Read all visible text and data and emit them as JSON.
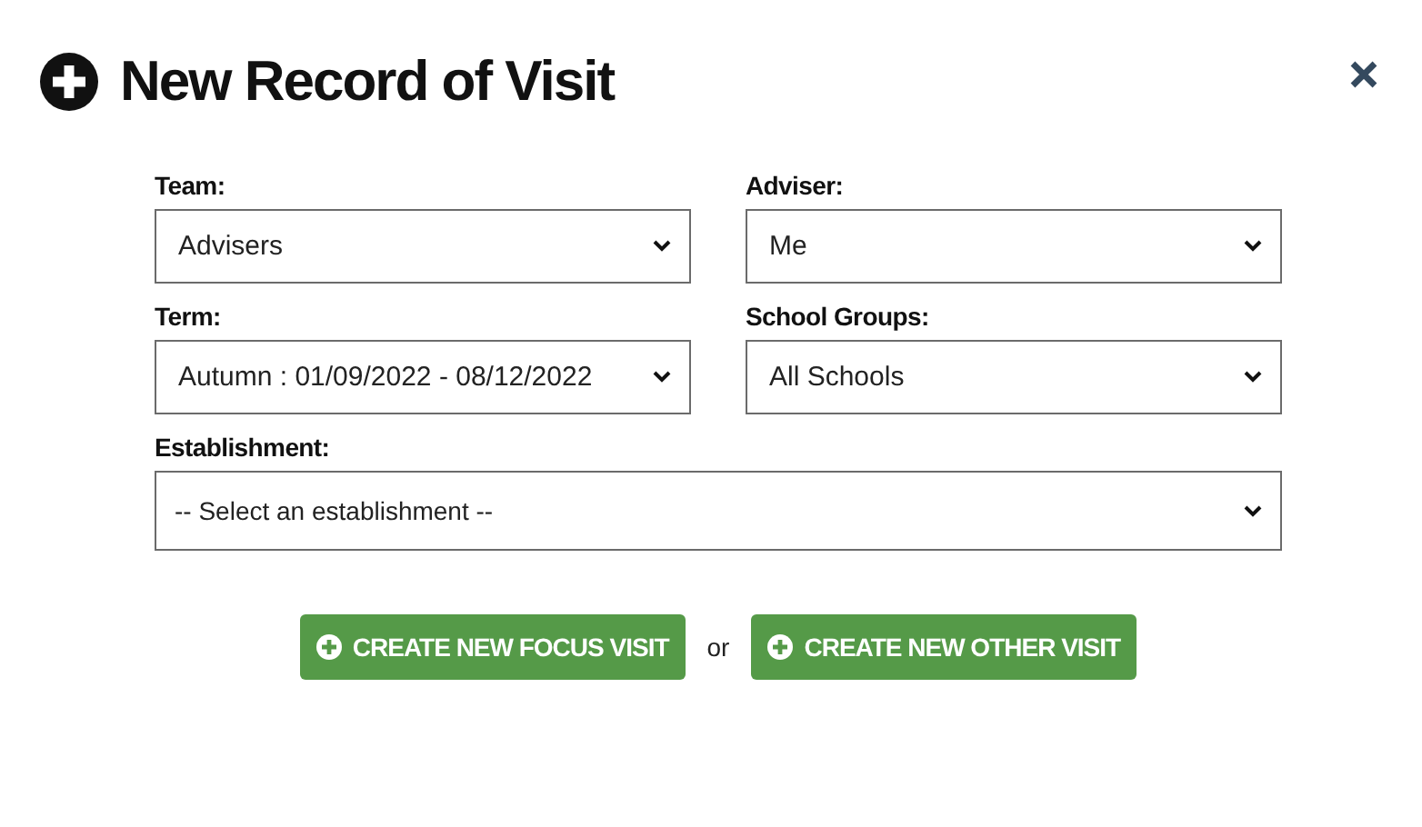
{
  "dialog": {
    "title": "New Record of Visit"
  },
  "fields": [
    {
      "label": "Team:",
      "value": "Advisers",
      "kind": "half"
    },
    {
      "label": "Adviser:",
      "value": "Me",
      "kind": "half"
    },
    {
      "label": "Term:",
      "value": "Autumn : 01/09/2022 - 08/12/2022",
      "kind": "half"
    },
    {
      "label": "School Groups:",
      "value": "All Schools",
      "kind": "half"
    },
    {
      "label": "Establishment:",
      "value": "-- Select an establishment --",
      "kind": "full"
    }
  ],
  "actions": {
    "buttons": [
      "CREATE NEW FOCUS VISIT",
      "CREATE NEW OTHER VISIT"
    ],
    "separator": "or"
  }
}
